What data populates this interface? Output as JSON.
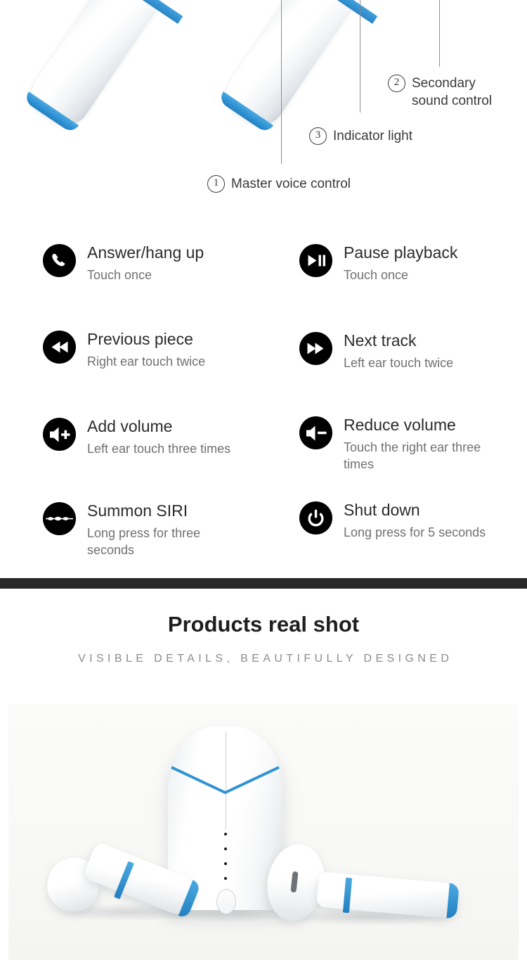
{
  "diagram": {
    "callouts": [
      {
        "num": "1",
        "label": "Master voice control",
        "icon": "circled-number-icon"
      },
      {
        "num": "2",
        "label": "Secondary\nsound control",
        "icon": "circled-number-icon"
      },
      {
        "num": "3",
        "label": "Indicator light",
        "icon": "circled-number-icon"
      }
    ]
  },
  "features": {
    "left": [
      {
        "icon": "phone-handset-icon",
        "title": "Answer/hang up",
        "desc": "Touch once"
      },
      {
        "icon": "previous-track-icon",
        "title": "Previous piece",
        "desc": "Right ear touch twice"
      },
      {
        "icon": "volume-up-icon",
        "title": "Add volume",
        "desc": "Left ear touch three times"
      },
      {
        "icon": "siri-waveform-icon",
        "title": "Summon SIRI",
        "desc": "Long press for three seconds"
      }
    ],
    "right": [
      {
        "icon": "play-pause-icon",
        "title": "Pause playback",
        "desc": "Touch once"
      },
      {
        "icon": "next-track-icon",
        "title": "Next track",
        "desc": "Left ear touch twice"
      },
      {
        "icon": "volume-down-icon",
        "title": "Reduce volume",
        "desc": "Touch the right ear three times"
      },
      {
        "icon": "power-icon",
        "title": "Shut down",
        "desc": "Long press for 5 seconds"
      }
    ]
  },
  "real_shot": {
    "title": "Products real shot",
    "subtitle": "VISIBLE DETAILS, BEAUTIFULLY DESIGNED",
    "photo_alt": "white wireless earbuds charging case with two earbuds"
  },
  "colors": {
    "accent_blue": "#2f93d4",
    "divider_dark": "#282828",
    "icon_black": "#000000",
    "title_text": "#2b2b2b",
    "muted_text": "#707070",
    "subtitle_text": "#8c8c8c"
  }
}
